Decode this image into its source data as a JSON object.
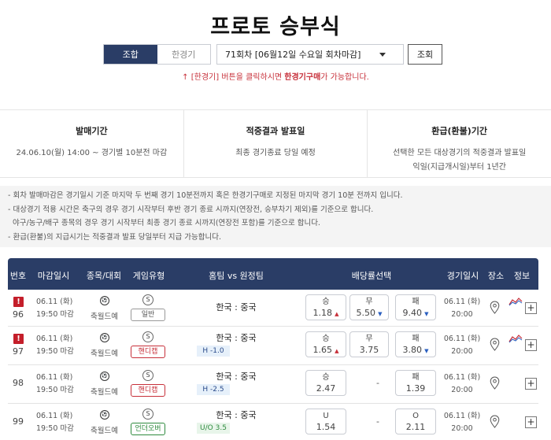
{
  "page_title": "프로토 승부식",
  "mode_tabs": [
    "조합",
    "한경기"
  ],
  "round_select": "71회차 [06월12일 수요일 회차마감]",
  "search_button": "조회",
  "notice": {
    "prefix": "[한경기] 버튼을 클릭하시면 ",
    "strong": "한경기구매",
    "suffix": "가 가능합니다."
  },
  "info": [
    {
      "title": "발매기간",
      "lines": [
        "24.06.10(월) 14:00 ~ 경기별 10분전 마감"
      ]
    },
    {
      "title": "적중결과 발표일",
      "lines": [
        "최종 경기종료 당일 예정"
      ]
    },
    {
      "title": "환급(환불)기간",
      "lines": [
        "선택한 모든 대상경기의 적중결과 발표일",
        "익일(지급개시일)부터 1년간"
      ]
    }
  ],
  "rules": [
    "- 회차 발매마감은 경기일시 기준 마지막 두 번째 경기 10분전까지 혹은 한경기구매로 지정된 마지막 경기 10분 전까지 입니다.",
    "- 대상경기 적용 시간은 축구의 경우 경기 시작부터 후반 경기 종료 시까지(연장전, 승부차기 제외)를 기준으로 합니다.",
    "  야구/농구/배구 종목의 경우 경기 시작부터 최종 경기 종료 시까지(연장전 포함)를 기준으로 합니다.",
    "- 환급(환불)의 지급시기는 적중결과 발표 당일부터 지급 가능합니다."
  ],
  "table_headers": [
    "번호",
    "마감일시",
    "종목/대회",
    "게임유형",
    "홈팀 vs 원정팀",
    "배당률선택",
    "경기일시",
    "장소",
    "정보"
  ],
  "rows": [
    {
      "alert": "!",
      "no": "96",
      "close_date": "06.11 (화)",
      "close_time": "19:50 마감",
      "sport": "축월드예",
      "game_icon": "S",
      "game_type": "일반",
      "type_style": "gray",
      "teams": "한국 : 중국",
      "handicap": "",
      "odds": [
        {
          "label": "승",
          "value": "1.18",
          "trend": "▲"
        },
        {
          "label": "무",
          "value": "5.50",
          "trend": "▼"
        },
        {
          "label": "패",
          "value": "9.40",
          "trend": "▼"
        }
      ],
      "game_date": "06.11 (화)",
      "game_time": "20:00",
      "has_chart": true,
      "plus": "+"
    },
    {
      "alert": "!",
      "no": "97",
      "close_date": "06.11 (화)",
      "close_time": "19:50 마감",
      "sport": "축월드예",
      "game_icon": "S",
      "game_type": "핸디캡",
      "type_style": "red",
      "teams": "한국 : 중국",
      "handicap": "H -1.0",
      "odds": [
        {
          "label": "승",
          "value": "1.65",
          "trend": "▲"
        },
        {
          "label": "무",
          "value": "3.75",
          "trend": ""
        },
        {
          "label": "패",
          "value": "3.80",
          "trend": "▼"
        }
      ],
      "game_date": "06.11 (화)",
      "game_time": "20:00",
      "has_chart": true,
      "plus": "+"
    },
    {
      "alert": "",
      "no": "98",
      "close_date": "06.11 (화)",
      "close_time": "19:50 마감",
      "sport": "축월드예",
      "game_icon": "S",
      "game_type": "핸디캡",
      "type_style": "red",
      "teams": "한국 : 중국",
      "handicap": "H -2.5",
      "odds": [
        {
          "label": "승",
          "value": "2.47",
          "trend": ""
        },
        {
          "label": "-",
          "value": "",
          "trend": ""
        },
        {
          "label": "패",
          "value": "1.39",
          "trend": ""
        }
      ],
      "game_date": "06.11 (화)",
      "game_time": "20:00",
      "has_chart": false,
      "plus": "+"
    },
    {
      "alert": "",
      "no": "99",
      "close_date": "06.11 (화)",
      "close_time": "19:50 마감",
      "sport": "축월드예",
      "game_icon": "S",
      "game_type": "언더오버",
      "type_style": "green",
      "teams": "한국 : 중국",
      "handicap": "U/O 3.5",
      "odds": [
        {
          "label": "U",
          "value": "1.54",
          "trend": ""
        },
        {
          "label": "-",
          "value": "",
          "trend": ""
        },
        {
          "label": "O",
          "value": "2.11",
          "trend": ""
        }
      ],
      "game_date": "06.11 (화)",
      "game_time": "20:00",
      "has_chart": false,
      "plus": "+"
    }
  ]
}
